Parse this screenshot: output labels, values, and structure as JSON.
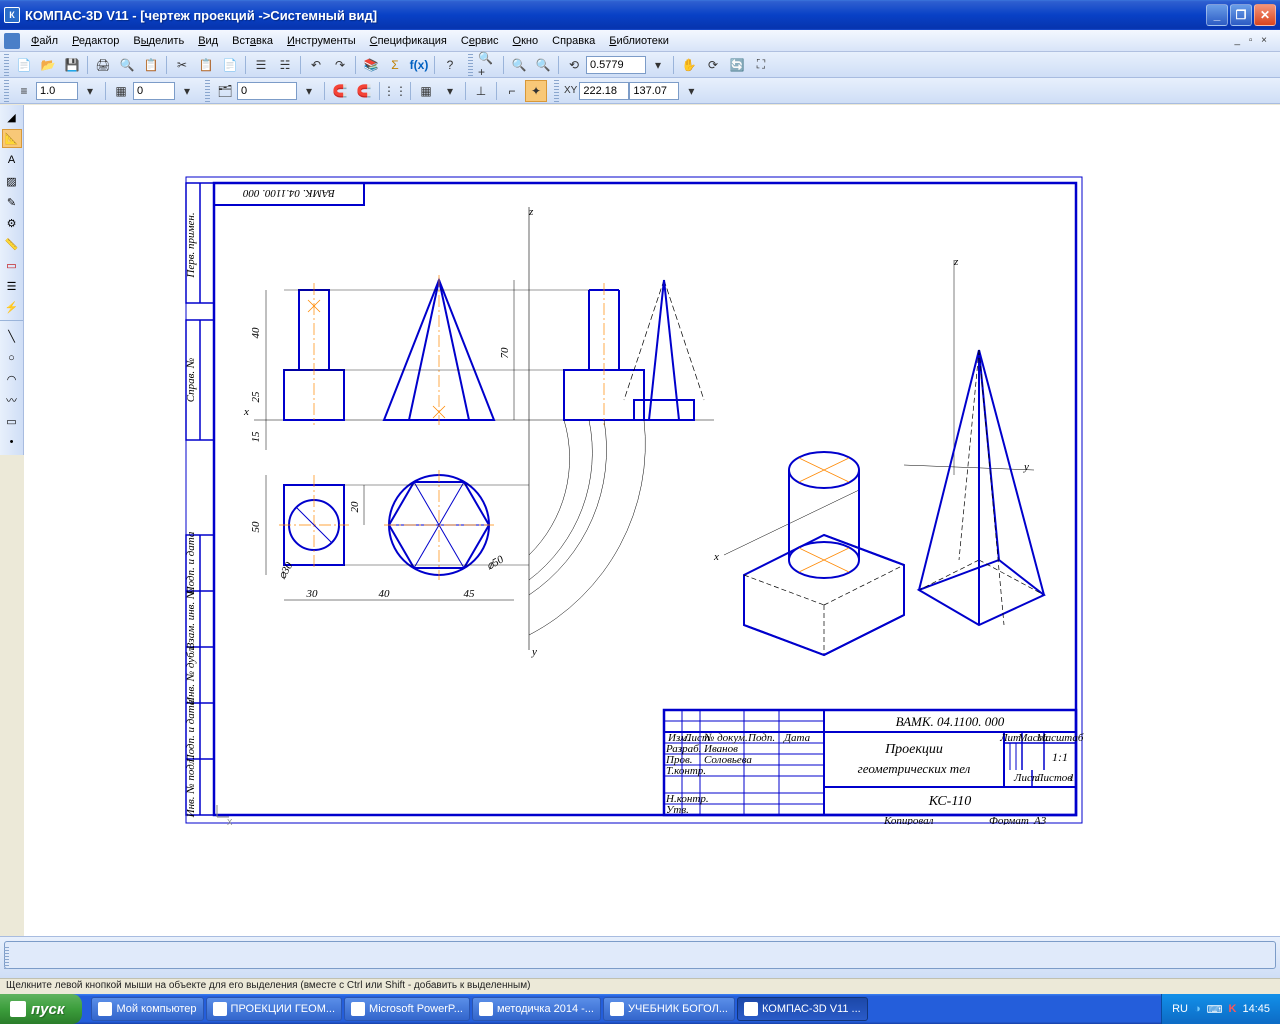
{
  "window": {
    "title": "КОМПАС-3D V11 - [чертеж проекций ->Системный вид]"
  },
  "menu": {
    "file": "Файл",
    "editor": "Редактор",
    "select": "Выделить",
    "view": "Вид",
    "insert": "Вставка",
    "tools": "Инструменты",
    "spec": "Спецификация",
    "service": "Сервис",
    "window": "Окно",
    "help": "Справка",
    "libraries": "Библиотеки"
  },
  "toolbar": {
    "zoom_value": "0.5779",
    "style_value": "1.0",
    "layer_value": "0",
    "layer2_value": "0",
    "coord_x": "222.18",
    "coord_y": "137.07",
    "xy_label": "XY"
  },
  "drawing": {
    "code_top": "ВАМК. 04.1100. 000",
    "axis_x": "x",
    "axis_y": "y",
    "axis_z": "z",
    "dim_40": "40",
    "dim_25": "25",
    "dim_15": "15",
    "dim_50": "50",
    "dim_20": "20",
    "dim_70": "70",
    "dim_30": "30",
    "dim_40b": "40",
    "dim_45": "45",
    "dim_d30": "⌀30",
    "dim_d50": "⌀50"
  },
  "titleblock": {
    "code": "ВАМК. 04.1100. 000",
    "title_line1": "Проекции",
    "title_line2": "геометрических тел",
    "group": "КС-110",
    "scale": "1:1",
    "sheets": "1",
    "format": "А3",
    "hdr_izm": "Изм.",
    "hdr_list": "Лист",
    "hdr_docnum": "№ докум.",
    "hdr_podp": "Подп.",
    "hdr_date": "Дата",
    "row_razrab": "Разраб.",
    "row_prov": "Пров.",
    "row_tkontr": "Т.контр.",
    "row_nkontr": "Н.контр.",
    "row_utv": "Утв.",
    "name1": "Иванов",
    "name2": "Соловьева",
    "hdr_lit": "Лит.",
    "hdr_massa": "Масса",
    "hdr_mashtab": "Масштаб",
    "hdr_list2": "Лист",
    "hdr_listov": "Листов",
    "kopiroval": "Копировал",
    "format_label": "Формат"
  },
  "sidebar_labels": {
    "perv_primen": "Перв. примен.",
    "sprav": "Справ. №",
    "podp_data": "Подп. и дата",
    "vzam_inv": "Взам. инв. №",
    "inv_dubl": "Инв. № дубл.",
    "podp_data2": "Подп. и дата",
    "inv_podl": "Инв. № подл."
  },
  "statusbar": {
    "hint": "Щелкните левой кнопкой мыши на объекте для его выделения (вместе с Ctrl или Shift - добавить к выделенным)"
  },
  "taskbar": {
    "start": "пуск",
    "items": [
      "Мой компьютер",
      "ПРОЕКЦИИ ГЕОМ...",
      "Microsoft PowerP...",
      "методичка 2014 -...",
      "УЧЕБНИК БОГОЛ...",
      "КОМПАС-3D V11 ..."
    ],
    "lang": "RU",
    "clock": "14:45"
  }
}
